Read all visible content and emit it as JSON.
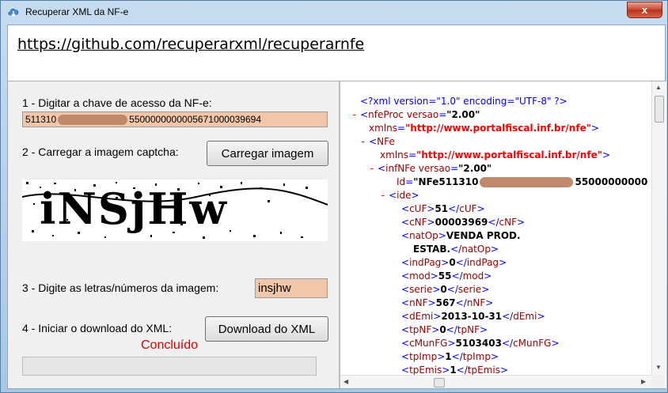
{
  "window": {
    "title": "Recuperar XML da NF-e",
    "close_glyph": "x"
  },
  "url_bar": {
    "link": "https://github.com/recuperarxml/recuperarnfe"
  },
  "form": {
    "step1_label": "1 - Digitar a chave de acesso da NF-e:",
    "key_prefix": "511310",
    "key_suffix": "5500000000005671000039694",
    "step2_label": "2 - Carregar a imagem captcha:",
    "load_button": "Carregar imagem",
    "captcha_text": "iNSjHw",
    "step3_label": "3 - Digite as letras/números da imagem:",
    "captcha_value": "insjhw",
    "step4_label": "4 - Iniciar o download do XML:",
    "download_button": "Download do XML",
    "status": "Concluído",
    "progress": 0
  },
  "xml": {
    "declaration": "<?xml version=\"1.0\" encoding=\"UTF-8\" ?>",
    "nfeproc_tag": "nfeProc",
    "nfeproc_attr": "versao",
    "nfeproc_val": "\"2.00\"",
    "xmlns_attr": "xmlns",
    "xmlns_val": "\"http://www.portalfiscal.inf.br/nfe\"",
    "nfe_tag": "NFe",
    "infnfe_tag": "infNFe",
    "infnfe_attr": "versao",
    "infnfe_val": "\"2.00\"",
    "id_attr": "Id",
    "id_prefix": "\"NFe511310",
    "id_suffix": "55000000000",
    "ide_tag": "ide",
    "fields": [
      {
        "tag": "cUF",
        "value": "51"
      },
      {
        "tag": "cNF",
        "value": "00003969"
      },
      {
        "tag": "natOp",
        "value": "VENDA PROD.",
        "value2": "ESTAB."
      },
      {
        "tag": "indPag",
        "value": "0"
      },
      {
        "tag": "mod",
        "value": "55"
      },
      {
        "tag": "serie",
        "value": "0"
      },
      {
        "tag": "nNF",
        "value": "567"
      },
      {
        "tag": "dEmi",
        "value": "2013-10-31"
      },
      {
        "tag": "tpNF",
        "value": "0"
      },
      {
        "tag": "cMunFG",
        "value": "5103403"
      },
      {
        "tag": "tpImp",
        "value": "1"
      },
      {
        "tag": "tpEmis",
        "value": "1"
      }
    ]
  }
}
